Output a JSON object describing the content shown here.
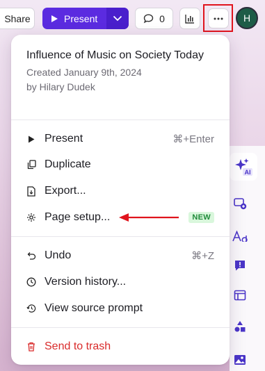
{
  "toolbar": {
    "share_label": "Share",
    "present_label": "Present",
    "comment_count": "0",
    "avatar_initial": "H",
    "more_icon": "more-dots-icon"
  },
  "menu": {
    "title": "Influence of Music on Society Today",
    "created": "Created January 9th, 2024",
    "author": "by Hilary Dudek",
    "items": [
      {
        "label": "Present",
        "shortcut": "⌘+Enter",
        "icon": "play-icon"
      },
      {
        "label": "Duplicate",
        "icon": "duplicate-icon"
      },
      {
        "label": "Export...",
        "icon": "export-icon"
      },
      {
        "label": "Page setup...",
        "badge": "NEW",
        "icon": "gear-icon"
      },
      {
        "label": "Undo",
        "shortcut": "⌘+Z",
        "icon": "undo-icon"
      },
      {
        "label": "Version history...",
        "icon": "clock-icon"
      },
      {
        "label": "View source prompt",
        "icon": "history-icon"
      },
      {
        "label": "Send to trash",
        "icon": "trash-icon"
      }
    ]
  },
  "rail": {
    "ai_label": "AI"
  },
  "colors": {
    "accent": "#5b2be0",
    "danger": "#d92b2b",
    "badge_bg": "#d9f7dc",
    "badge_fg": "#1f8a3a",
    "annotation": "#e0141d"
  }
}
